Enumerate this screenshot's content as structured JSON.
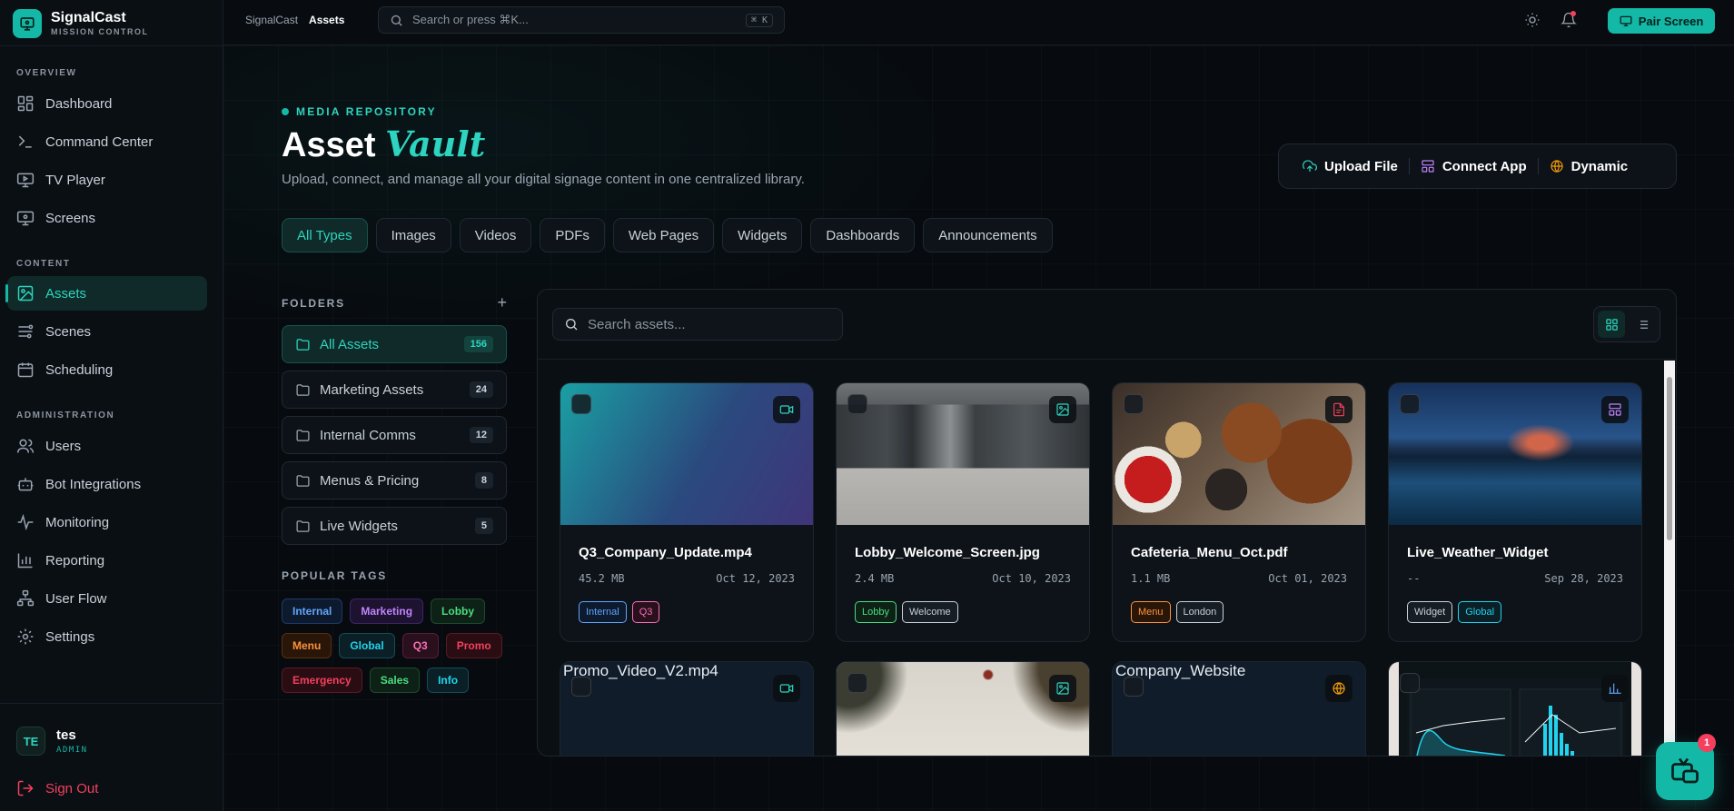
{
  "brand": {
    "name": "SignalCast",
    "subtitle": "MISSION CONTROL"
  },
  "sidebar": {
    "sections": [
      {
        "title": "OVERVIEW"
      },
      {
        "title": "CONTENT"
      },
      {
        "title": "ADMINISTRATION"
      }
    ],
    "items": [
      {
        "label": "Dashboard",
        "icon": "dashboard-icon"
      },
      {
        "label": "Command Center",
        "icon": "terminal-icon"
      },
      {
        "label": "TV Player",
        "icon": "tv-icon"
      },
      {
        "label": "Screens",
        "icon": "monitor-icon"
      },
      {
        "label": "Assets",
        "icon": "image-icon",
        "active": true
      },
      {
        "label": "Scenes",
        "icon": "layers-icon"
      },
      {
        "label": "Scheduling",
        "icon": "calendar-icon"
      },
      {
        "label": "Users",
        "icon": "users-icon"
      },
      {
        "label": "Bot Integrations",
        "icon": "bot-icon"
      },
      {
        "label": "Monitoring",
        "icon": "activity-icon"
      },
      {
        "label": "Reporting",
        "icon": "bar-chart-icon"
      },
      {
        "label": "User Flow",
        "icon": "flow-icon"
      },
      {
        "label": "Settings",
        "icon": "gear-icon"
      }
    ],
    "user": {
      "initials": "TE",
      "name": "tes",
      "role": "ADMIN"
    },
    "signout": "Sign Out"
  },
  "topbar": {
    "breadcrumbs": [
      "SignalCast",
      "Assets"
    ],
    "search_placeholder": "Search or press ⌘K...",
    "search_shortcut": "⌘ K",
    "pair_button": "Pair Screen"
  },
  "header": {
    "eyebrow": "MEDIA REPOSITORY",
    "title_main": "Asset",
    "title_accent": "Vault",
    "subtitle": "Upload, connect, and manage all your digital signage content in one centralized library.",
    "actions": [
      {
        "label": "Upload File",
        "icon": "upload-cloud-icon",
        "color": "#2dd4bf"
      },
      {
        "label": "Connect App",
        "icon": "app-grid-icon",
        "color": "#c084fc"
      },
      {
        "label": "Dynamic",
        "icon": "globe-icon",
        "color": "#f59e0b"
      }
    ]
  },
  "filters": [
    "All Types",
    "Images",
    "Videos",
    "PDFs",
    "Web Pages",
    "Widgets",
    "Dashboards",
    "Announcements"
  ],
  "folders": {
    "title": "FOLDERS",
    "add": "+",
    "items": [
      {
        "label": "All Assets",
        "count": "156",
        "active": true
      },
      {
        "label": "Marketing Assets",
        "count": "24"
      },
      {
        "label": "Internal Comms",
        "count": "12"
      },
      {
        "label": "Menus & Pricing",
        "count": "8"
      },
      {
        "label": "Live Widgets",
        "count": "5"
      }
    ]
  },
  "tags": {
    "title": "POPULAR TAGS",
    "items": [
      {
        "label": "Internal",
        "style": "blue"
      },
      {
        "label": "Marketing",
        "style": "purple"
      },
      {
        "label": "Lobby",
        "style": "green"
      },
      {
        "label": "Menu",
        "style": "orange"
      },
      {
        "label": "Global",
        "style": "cyan"
      },
      {
        "label": "Q3",
        "style": "pink"
      },
      {
        "label": "Promo",
        "style": "red"
      },
      {
        "label": "Emergency",
        "style": "red"
      },
      {
        "label": "Sales",
        "style": "green"
      },
      {
        "label": "Info",
        "style": "cyan"
      }
    ]
  },
  "assets": {
    "search_placeholder": "Search assets...",
    "items": [
      {
        "name": "Q3_Company_Update.mp4",
        "size": "45.2 MB",
        "date": "Oct 12, 2023",
        "type_icon": "video-icon",
        "type_color": "#2dd4bf",
        "tags": [
          {
            "label": "Internal",
            "style": "blue"
          },
          {
            "label": "Q3",
            "style": "pink"
          }
        ]
      },
      {
        "name": "Lobby_Welcome_Screen.jpg",
        "size": "2.4 MB",
        "date": "Oct 10, 2023",
        "type_icon": "image-icon",
        "type_color": "#2dd4bf",
        "tags": [
          {
            "label": "Lobby",
            "style": "green"
          },
          {
            "label": "Welcome",
            "style": "gray"
          }
        ]
      },
      {
        "name": "Cafeteria_Menu_Oct.pdf",
        "size": "1.1 MB",
        "date": "Oct 01, 2023",
        "type_icon": "file-icon",
        "type_color": "#f43f5e",
        "tags": [
          {
            "label": "Menu",
            "style": "orange"
          },
          {
            "label": "London",
            "style": "gray"
          }
        ]
      },
      {
        "name": "Live_Weather_Widget",
        "size": "--",
        "date": "Sep 28, 2023",
        "type_icon": "widget-icon",
        "type_color": "#c084fc",
        "tags": [
          {
            "label": "Widget",
            "style": "gray"
          },
          {
            "label": "Global",
            "style": "cyan"
          }
        ]
      }
    ],
    "row2": [
      {
        "alt": "Promo_Video_V2.mp4",
        "type_icon": "video-icon",
        "type_color": "#2dd4bf"
      },
      {
        "alt": "",
        "type_icon": "image-icon",
        "type_color": "#2dd4bf"
      },
      {
        "alt": "Company_Website",
        "type_icon": "globe-icon",
        "type_color": "#f59e0b"
      },
      {
        "alt": "",
        "type_icon": "chart-icon",
        "type_color": "#60a5fa"
      }
    ]
  },
  "fab": {
    "badge": "1"
  }
}
